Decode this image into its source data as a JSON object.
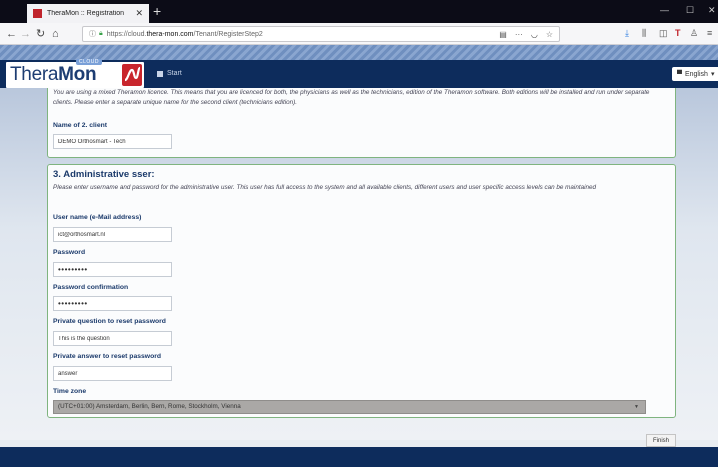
{
  "browser": {
    "tab_title": "TheraMon :: Registration",
    "url_prefix": "https://cloud.",
    "url_host": "thera-mon.com",
    "url_path": "/Tenant/RegisterStep2"
  },
  "header": {
    "logo_thera": "Thera",
    "logo_mon": "Mon",
    "logo_cloud": "CLOUD",
    "start_label": "Start",
    "language": "English"
  },
  "client_section": {
    "note": "You are using a mixed Theramon licence. This means that you are licenced for both, the physicians as well as the technicians, edition of the Theramon software. Both editions will be installed and run under separate clients. Please enter a separate unique name for the second client (technicians edition).",
    "name_label": "Name of 2. client",
    "name_value": "DEMO Orthosmart - Tech"
  },
  "admin_section": {
    "title": "3. Administrative sser:",
    "note": "Please enter username and password for the administrative user. This user has full access to the system and all available clients, different users and user specific access levels can be maintained",
    "username_label": "User name (e-Mail address)",
    "username_value": "ict@orthosmart.nl",
    "password_label": "Password",
    "password_value": "•••••••••",
    "confirm_label": "Password confirmation",
    "confirm_value": "•••••••••",
    "question_label": "Private question to reset password",
    "question_value": "This is the question",
    "answer_label": "Private answer to reset password",
    "answer_value": "answer",
    "timezone_label": "Time zone",
    "timezone_value": "(UTC+01:00) Amsterdam, Berlin, Bern, Rome, Stockholm, Vienna"
  },
  "actions": {
    "finish_label": "Finish"
  },
  "colors": {
    "header_bg": "#0d2c5c",
    "label_color": "#1b3a6b",
    "panel_border": "#7fb47f",
    "logo_red": "#c8262d"
  }
}
